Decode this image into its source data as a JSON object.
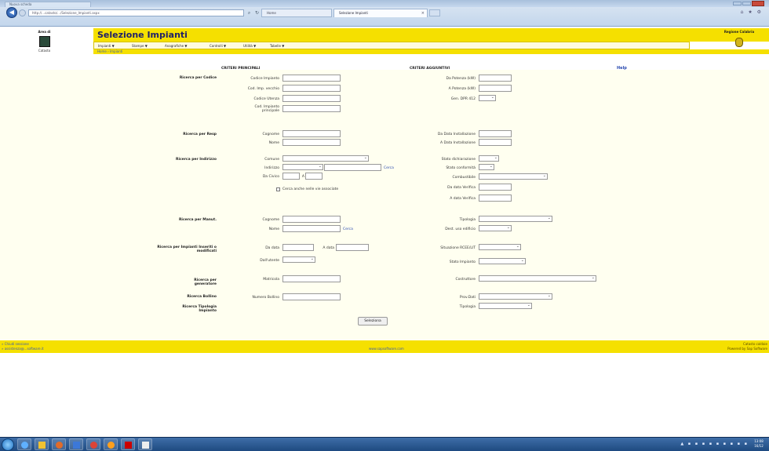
{
  "browser": {
    "small_tab": "Nuova scheda",
    "address": "http://...catasto/.../Selezione_Impianti.aspx",
    "tab1": "Home",
    "tab2": "Selezione Impianti",
    "tab_close": "×",
    "toolbar_icons": "⌂ ★ ⚙"
  },
  "header": {
    "area_label": "Area di",
    "area_sub": "Catasto",
    "title": "Selezione Impianti",
    "menu": [
      "Impianti ▼",
      "Stampe ▼",
      "Anagrafiche ▼",
      "Controlli ▼",
      "Utilità ▼",
      "Tabelle ▼"
    ],
    "breadcrumb": "Home › Impianti",
    "region_label": "Regione Calabria"
  },
  "form": {
    "heading_main": "CRITERI PRINCIPALI",
    "heading_extra": "CRITERI AGGIUNTIVI",
    "help": "Help",
    "groups": {
      "codice": "Ricerca per Codice",
      "resp": "Ricerca per Resp",
      "indirizzo": "Ricerca per Indirizzo",
      "manut": "Ricerca per Manut.",
      "inseriti": "Ricerca per Impianti Inseriti o modificati",
      "generatore": "Ricerca per generatore",
      "bollino": "Ricerca Bollino",
      "tipologia": "Ricerca Tipologia Impianto"
    },
    "labels": {
      "codice_impianto": "Codice Impianto",
      "cod_imp_vecchio": "Cod. Imp. vecchio",
      "codice_utenza": "Codice Utenza",
      "cod_impianto_principale": "Cod. Impianto principale",
      "cognome": "Cognome",
      "nome": "Nome",
      "comune": "Comune",
      "indirizzo": "Indirizzo",
      "da_civico": "Da Civico",
      "a": "A",
      "cerca_vie": "Cerca anche nelle vie associate",
      "cognome2": "Cognome",
      "nome2": "Nome",
      "da_data": "Da data",
      "a_data": "A data",
      "dall_utente": "Dall'utente",
      "matricola": "Matricola",
      "numero_bollino": "Numero Bollino",
      "da_potenza": "Da Potenza (kW)",
      "a_potenza": "A Potenza (kW)",
      "gen_dpr": "Gen. DPR 412",
      "da_data_inst": "Da Data Installazione",
      "a_data_inst": "A Data Installazione",
      "stato_dich": "Stato dichiarazione",
      "stato_conf": "Stato conformità",
      "combustibile": "Combustibile",
      "da_data_verifica": "Da data Verifica",
      "a_data_verifica": "A data Verifica",
      "tipologia": "Tipologia",
      "dest_uso": "Dest. uso edificio",
      "situazione": "Situazione RCEE/LIT",
      "stato_impianto": "Stato Impianto",
      "costruttore": "Costruttore",
      "prov_dati": "Prov.Dati",
      "tipologia2": "Tipologia"
    },
    "cerca_link": "Cerca",
    "cerca_link2": "Cerca",
    "search_button": "Seleziona"
  },
  "footer": {
    "left1": "» Chiudi sessione",
    "left2": "» assistenza@...software.it",
    "center": "www.sapsoftware.com",
    "right1": "Catasto caldaie",
    "right2": "Powered by Sap Software"
  },
  "taskbar": {
    "tray": "▲ ▪ ▪ ▪ ▪ ▪ ▪ ▪ ▪ ▪",
    "time": "13:08",
    "date": "16/12"
  },
  "colors": {
    "brand_yellow": "#f5e000",
    "title_blue": "#1f1f6a",
    "link_blue": "#2a4ab0",
    "form_bg": "#fffff0"
  }
}
